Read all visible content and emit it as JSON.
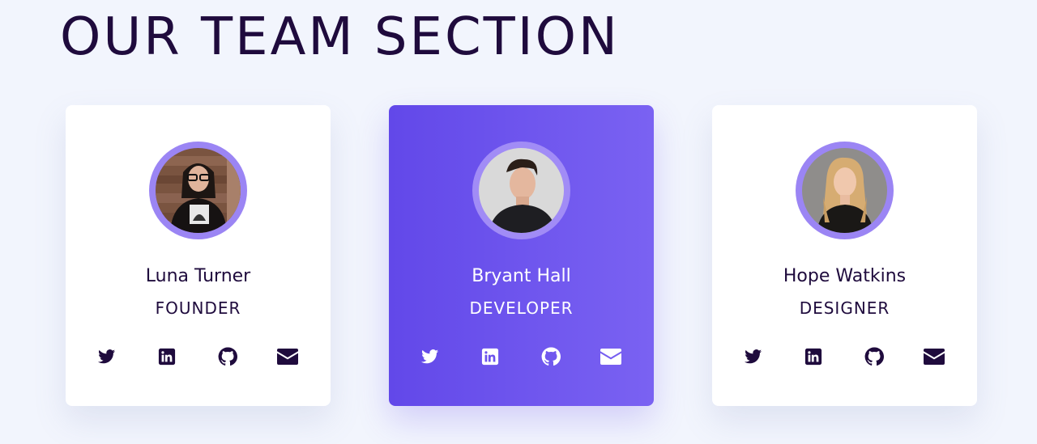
{
  "section": {
    "title": "OUR TEAM SECTION"
  },
  "colors": {
    "page_background": "#f2f5fd",
    "text_dark": "#1f0b3d",
    "accent": "#6248e9",
    "accent_light": "#7a62f2",
    "avatar_ring": "#9b85f4"
  },
  "team": [
    {
      "name": "Luna Turner",
      "role": "FOUNDER",
      "featured": false,
      "social": [
        "twitter-icon",
        "linkedin-icon",
        "github-icon",
        "email-icon"
      ]
    },
    {
      "name": "Bryant Hall",
      "role": "DEVELOPER",
      "featured": true,
      "social": [
        "twitter-icon",
        "linkedin-icon",
        "github-icon",
        "email-icon"
      ]
    },
    {
      "name": "Hope Watkins",
      "role": "DESIGNER",
      "featured": false,
      "social": [
        "twitter-icon",
        "linkedin-icon",
        "github-icon",
        "email-icon"
      ]
    }
  ]
}
